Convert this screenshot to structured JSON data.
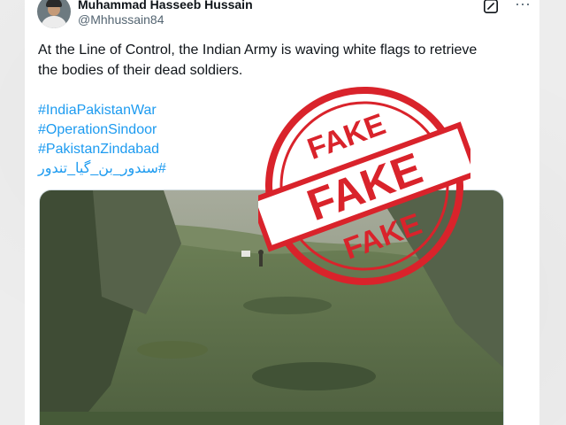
{
  "post": {
    "author_name": "Muhammad Hasseeb Hussain",
    "author_handle": "@Mhhussain84",
    "text": "At the Line of Control, the Indian Army is waving white flags to retrieve the bodies of their dead soldiers.",
    "hashtags": [
      "#IndiaPakistanWar",
      "#OperationSindoor",
      "#PakistanZindabad",
      "#سندور_بن_گیا_تندور"
    ]
  },
  "icons": {
    "avatar": "avatar",
    "grok": "grok-icon",
    "more": "more-options-icon"
  },
  "stamp": {
    "top": "FAKE",
    "center": "FAKE",
    "bottom": "FAKE",
    "color": "#d9232b"
  },
  "colors": {
    "link": "#1d9bf0",
    "text": "#0f1419",
    "secondary": "#536471"
  }
}
